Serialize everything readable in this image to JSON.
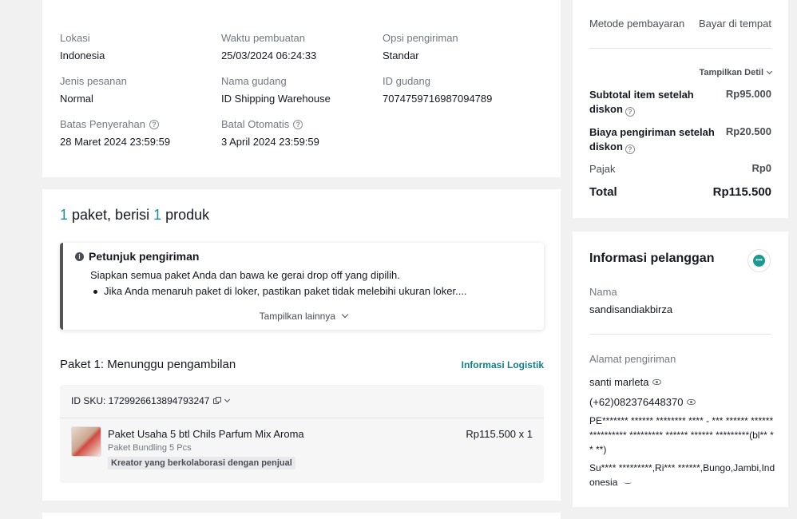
{
  "order_info": {
    "items": [
      {
        "label": "Lokasi",
        "value": "Indonesia"
      },
      {
        "label": "Waktu pembuatan",
        "value": "25/03/2024 06:24:33"
      },
      {
        "label": "Opsi pengiriman",
        "value": "Standar"
      },
      {
        "label": "Jenis pesanan",
        "value": "Normal"
      },
      {
        "label": "Nama gudang",
        "value": "ID Shipping Warehouse"
      },
      {
        "label": "ID gudang",
        "value": "7074759716987094789"
      },
      {
        "label": "Batas Penyerahan",
        "value": "28 Maret 2024 23:59:59"
      },
      {
        "label": "Batal Otomatis",
        "value": "3 April 2024 23:59:59"
      }
    ]
  },
  "package": {
    "count": "1",
    "text_mid": " paket, berisi ",
    "product_count": "1",
    "text_end": " produk",
    "tips_title": "Petunjuk pengiriman",
    "tips_line": "Siapkan semua paket Anda dan bawa ke gerai drop off yang dipilih.",
    "tips_bullet": "Jika Anda menaruh paket di loker, pastikan paket tidak melebihi ukuran loker....",
    "show_more": "Tampilkan lainnya",
    "pkg_label": "Paket 1:",
    "pkg_status": " Menunggu pengambilan",
    "logistic_link": "Informasi Logistik",
    "sku": "ID SKU: 1729926613894793247",
    "product_name": "Paket Usaha 5 btl Chils Parfum Mix Aroma",
    "product_variant": "Paket Bundling 5 Pcs",
    "product_tag": "Kreator yang berkolaborasi dengan penjual",
    "product_price": "Rp115.500 x 1"
  },
  "payment": {
    "method_label": "Metode pembayaran",
    "method_value": "Bayar di tempat",
    "show_detail": "Tampilkan Detil",
    "subtotal_label": "Subtotal item setelah diskon",
    "subtotal_value": "Rp95.000",
    "shipping_label": "Biaya pengiriman setelah diskon",
    "shipping_value": "Rp20.500",
    "tax_label": "Pajak",
    "tax_value": "Rp0",
    "total_label": "Total",
    "total_value": "Rp115.500"
  },
  "customer": {
    "title": "Informasi pelanggan",
    "name_label": "Nama",
    "name_value": "sandisandiakbirza",
    "address_label": "Alamat pengiriman",
    "recipient": "santi marleta",
    "phone": "(+62)082376448370",
    "address_line1": "PE******* ****** ******** **** - *** ****** ****** ********** ********* ****** ****** *********(bl** ** **)",
    "address_line2": "Su**** *********,Ri*** ******,Bungo,Jambi,Indonesia"
  }
}
